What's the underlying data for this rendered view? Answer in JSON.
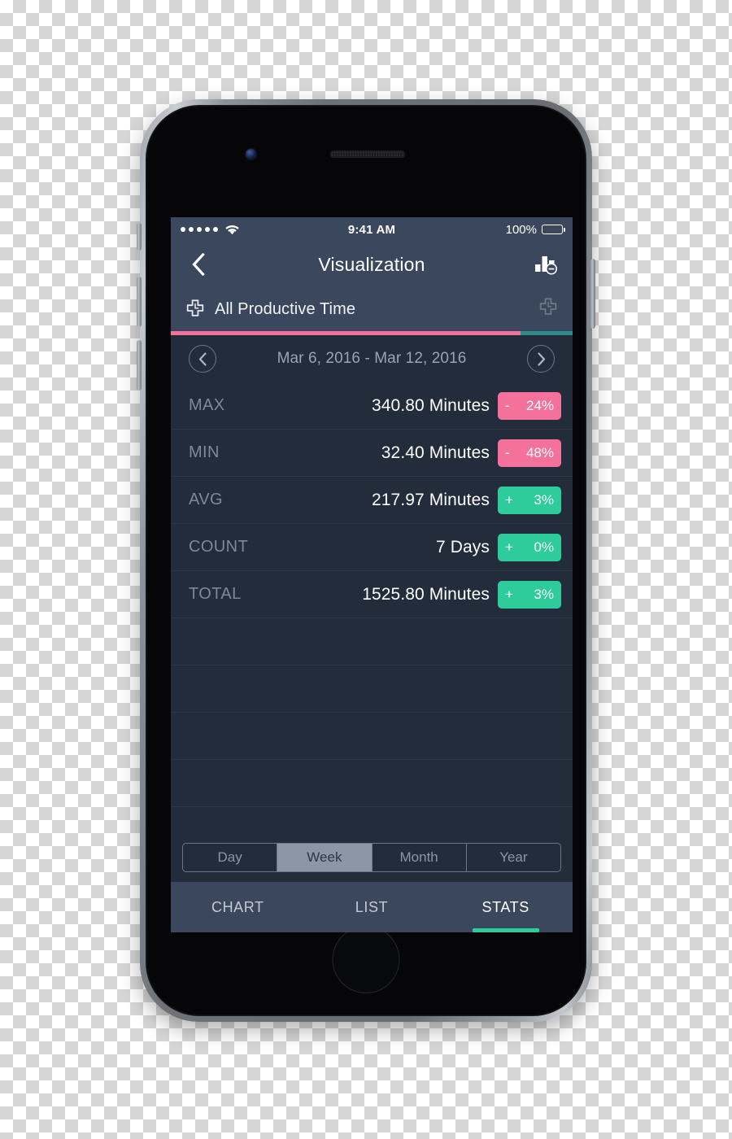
{
  "device": {
    "camera_icon": "front-camera",
    "speaker_icon": "earpiece-speaker",
    "home_button": "home-button"
  },
  "status_bar": {
    "signal_dots": 5,
    "wifi_icon": "wifi-icon",
    "time": "9:41 AM",
    "battery_percent": "100%",
    "battery_icon": "battery-full-icon"
  },
  "nav": {
    "back_icon": "chevron-left-icon",
    "title": "Visualization",
    "chart_icon": "bar-chart-minus-icon"
  },
  "category": {
    "left_icon": "cross-clock-icon",
    "label": "All Productive Time",
    "right_icon": "cross-clock-icon"
  },
  "progress": {
    "primary_pct": 87,
    "primary_color": "#F4719B",
    "secondary_color": "#2E8B87"
  },
  "date_nav": {
    "prev_icon": "chevron-left-circle-icon",
    "range": "Mar 6, 2016 - Mar 12, 2016",
    "next_icon": "chevron-right-circle-icon"
  },
  "colors": {
    "negative": "#F4719B",
    "positive": "#2ECC9B",
    "screen_bg": "#222C3A",
    "chrome_bg": "#3B475C",
    "accent_teal": "#2ECC9B"
  },
  "stats": {
    "rows": [
      {
        "key": "MAX",
        "value": "340.80 Minutes",
        "sign": "-",
        "pct": "24%",
        "trend": "negative"
      },
      {
        "key": "MIN",
        "value": "32.40 Minutes",
        "sign": "-",
        "pct": "48%",
        "trend": "negative"
      },
      {
        "key": "AVG",
        "value": "217.97 Minutes",
        "sign": "+",
        "pct": "3%",
        "trend": "positive"
      },
      {
        "key": "COUNT",
        "value": "7 Days",
        "sign": "+",
        "pct": "0%",
        "trend": "positive"
      },
      {
        "key": "TOTAL",
        "value": "1525.80 Minutes",
        "sign": "+",
        "pct": "3%",
        "trend": "positive"
      }
    ],
    "empty_row_count": 4
  },
  "segment": {
    "options": [
      {
        "label": "Day",
        "active": false
      },
      {
        "label": "Week",
        "active": true
      },
      {
        "label": "Month",
        "active": false
      },
      {
        "label": "Year",
        "active": false
      }
    ]
  },
  "tabbar": {
    "tabs": [
      {
        "label": "CHART",
        "active": false
      },
      {
        "label": "LIST",
        "active": false
      },
      {
        "label": "STATS",
        "active": true
      }
    ]
  }
}
